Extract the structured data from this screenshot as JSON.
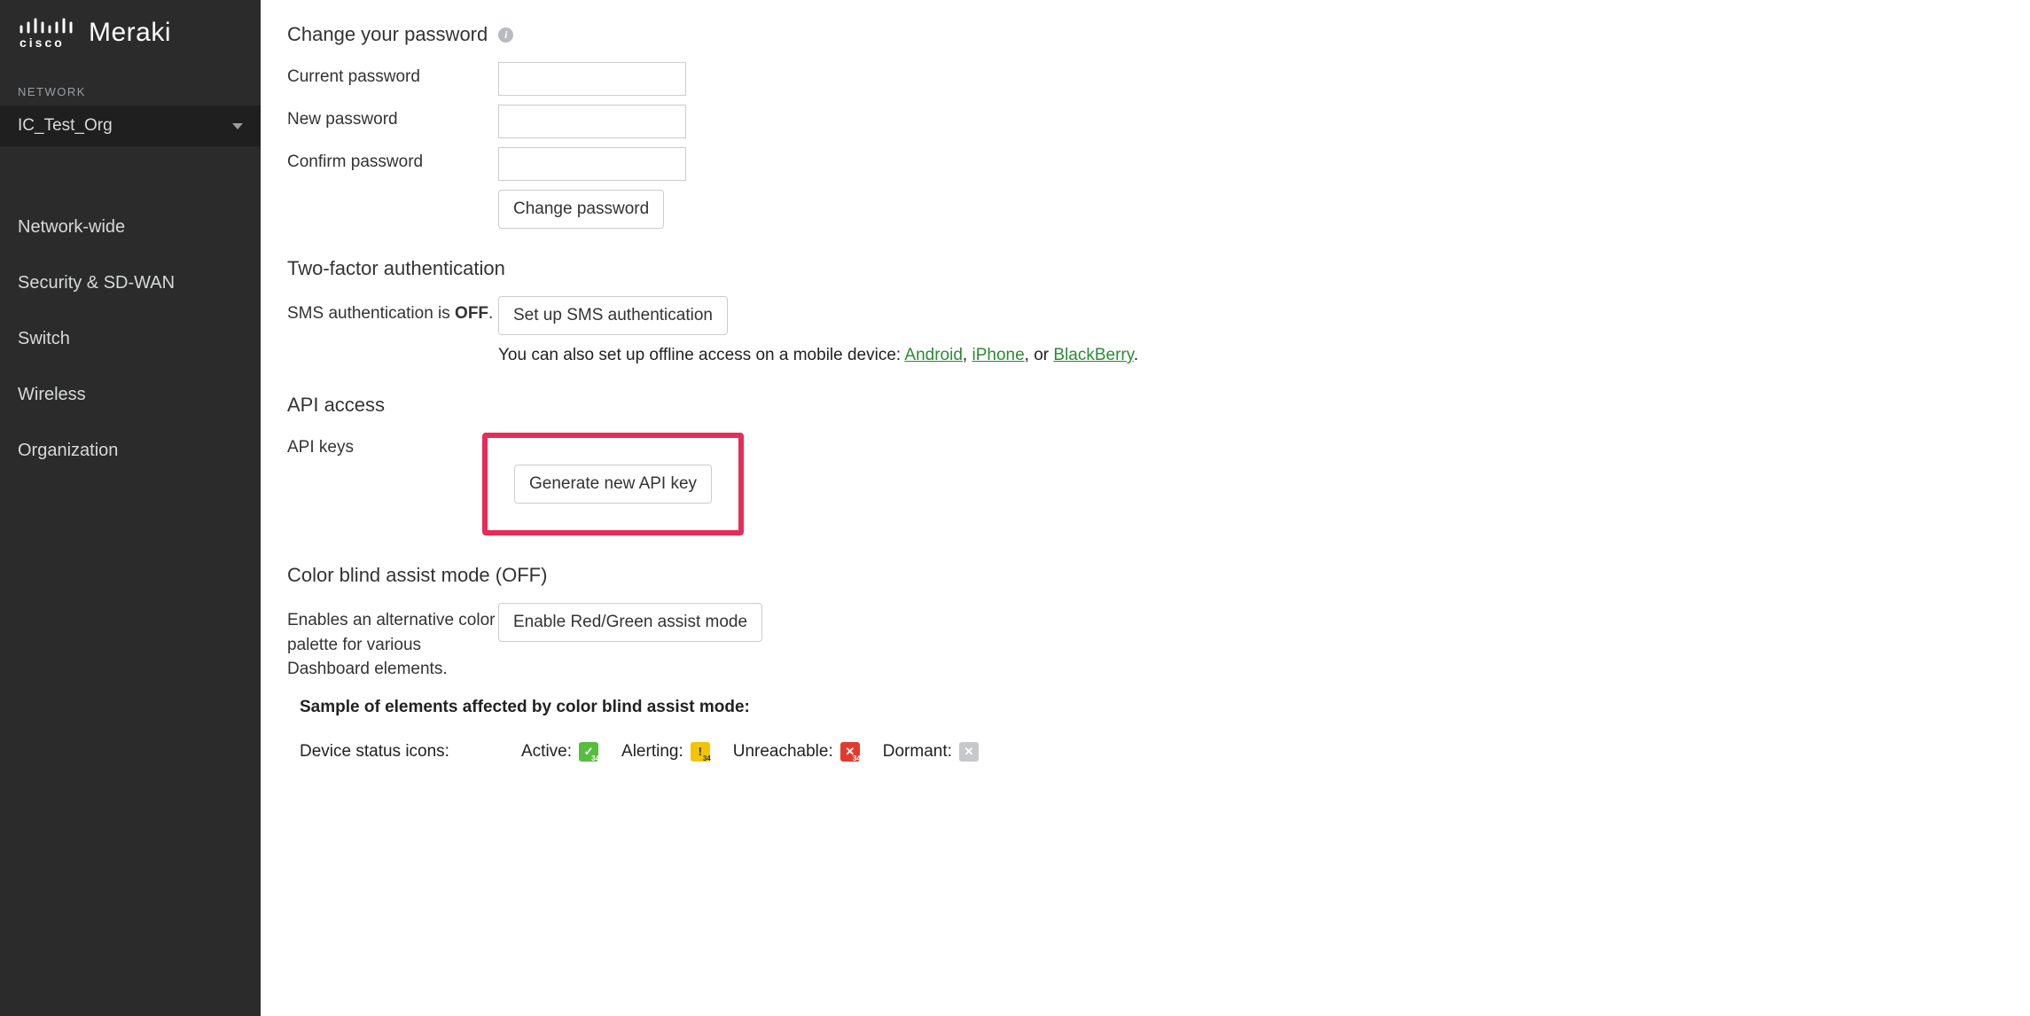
{
  "sidebar": {
    "brand_sub": "Meraki",
    "network_label": "NETWORK",
    "network_name": "IC_Test_Org",
    "items": [
      {
        "label": "Network-wide"
      },
      {
        "label": "Security & SD-WAN"
      },
      {
        "label": "Switch"
      },
      {
        "label": "Wireless"
      },
      {
        "label": "Organization"
      }
    ]
  },
  "password_section": {
    "title": "Change your password",
    "current_label": "Current password",
    "new_label": "New password",
    "confirm_label": "Confirm password",
    "button": "Change password"
  },
  "twofactor_section": {
    "title": "Two-factor authentication",
    "status_prefix": "SMS authentication is",
    "status_value": "OFF",
    "status_suffix": ".",
    "button": "Set up SMS authentication",
    "offline_prefix": "You can also set up offline access on a mobile device: ",
    "links": {
      "android": "Android",
      "iphone": "iPhone",
      "blackberry": "BlackBerry"
    },
    "sep1": ", ",
    "sep2": ", or ",
    "offline_suffix": "."
  },
  "api_section": {
    "title": "API access",
    "keys_label": "API keys",
    "button": "Generate new API key"
  },
  "colorblind_section": {
    "title": "Color blind assist mode (OFF)",
    "desc": "Enables an alternative color palette for various Dashboard elements.",
    "button": "Enable Red/Green assist mode",
    "sample_title": "Sample of elements affected by color blind assist mode:",
    "icons_label": "Device status icons:",
    "statuses": {
      "active": "Active:",
      "alerting": "Alerting:",
      "unreachable": "Unreachable:",
      "dormant": "Dormant:"
    },
    "value": "34"
  }
}
